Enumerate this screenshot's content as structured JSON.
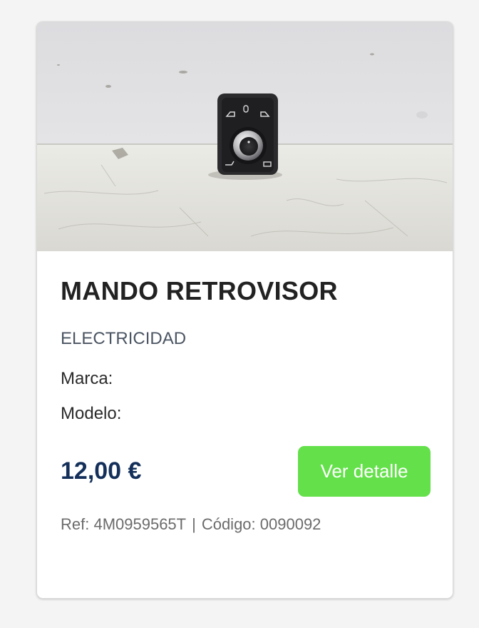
{
  "product": {
    "title": "MANDO RETROVISOR",
    "category": "ELECTRICIDAD",
    "brand_label": "Marca:",
    "model_label": "Modelo:",
    "price": "12,00 €",
    "detail_button": "Ver detalle",
    "ref_text": "Ref: 4M0959565T",
    "separator": "|",
    "code_text": "Código: 0090092"
  },
  "colors": {
    "button": "#63e04a",
    "price": "#14305a",
    "title": "#222222"
  },
  "icons": {
    "photo": "product-photo-mirror-switch"
  }
}
